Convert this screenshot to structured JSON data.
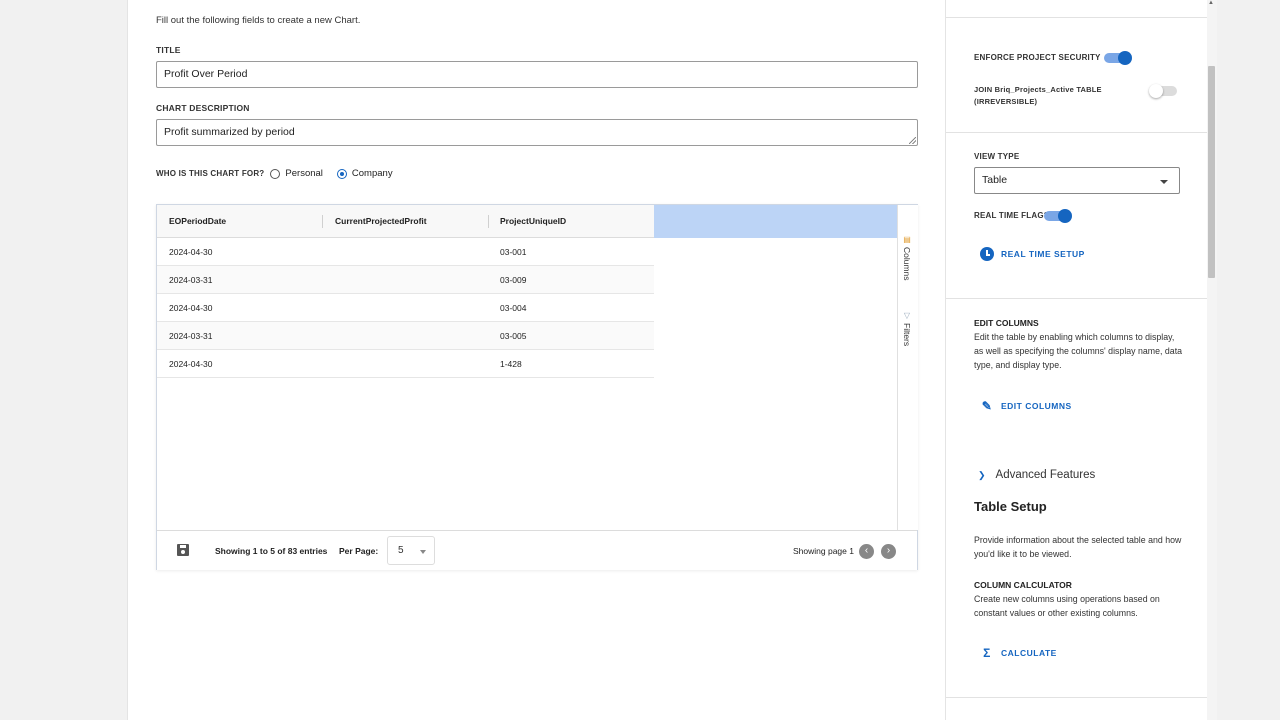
{
  "form": {
    "intro": "Fill out the following fields to create a new Chart.",
    "title_label": "TITLE",
    "title_value": "Profit Over Period",
    "description_label": "CHART DESCRIPTION",
    "description_value": "Profit summarized by period",
    "audience_question": "WHO IS THIS CHART FOR?",
    "audience_options": [
      "Personal",
      "Company"
    ],
    "audience_selected": "Company"
  },
  "grid": {
    "columns": [
      "EOPeriodDate",
      "CurrentProjectedProfit",
      "ProjectUniqueID"
    ],
    "rows": [
      [
        "2024-04-30",
        "",
        "03-001"
      ],
      [
        "2024-03-31",
        "",
        "03-009"
      ],
      [
        "2024-04-30",
        "",
        "03-004"
      ],
      [
        "2024-03-31",
        "",
        "03-005"
      ],
      [
        "2024-04-30",
        "",
        "1-428"
      ]
    ],
    "side_tabs": [
      "Columns",
      "Filters"
    ],
    "footer": {
      "showing": "Showing 1 to 5 of 83 entries",
      "per_page_label": "Per Page:",
      "per_page_value": "5",
      "page_label": "Showing page 1"
    }
  },
  "settings": {
    "enforce_security_label": "ENFORCE PROJECT SECURITY",
    "enforce_security_on": true,
    "join_label": "JOIN Briq_Projects_Active TABLE (IRREVERSIBLE)",
    "join_on": false,
    "view_type_label": "VIEW TYPE",
    "view_type_value": "Table",
    "real_time_label": "REAL TIME FLAG?",
    "real_time_on": true,
    "real_time_setup": "REAL TIME SETUP",
    "edit_columns_title": "EDIT COLUMNS",
    "edit_columns_desc": "Edit the table by enabling which columns to display, as well as specifying the columns' display name, data type, and display type.",
    "edit_columns_action": "EDIT COLUMNS",
    "advanced_features": "Advanced Features",
    "table_setup_title": "Table Setup",
    "table_setup_desc": "Provide information about the selected table and how you'd like it to be viewed.",
    "column_calc_title": "COLUMN CALCULATOR",
    "column_calc_desc": "Create new columns using operations based on constant values or other existing columns.",
    "calculate_action": "CALCULATE"
  },
  "colors": {
    "accent": "#1565c0",
    "header_highlight": "#bcd4f6"
  }
}
